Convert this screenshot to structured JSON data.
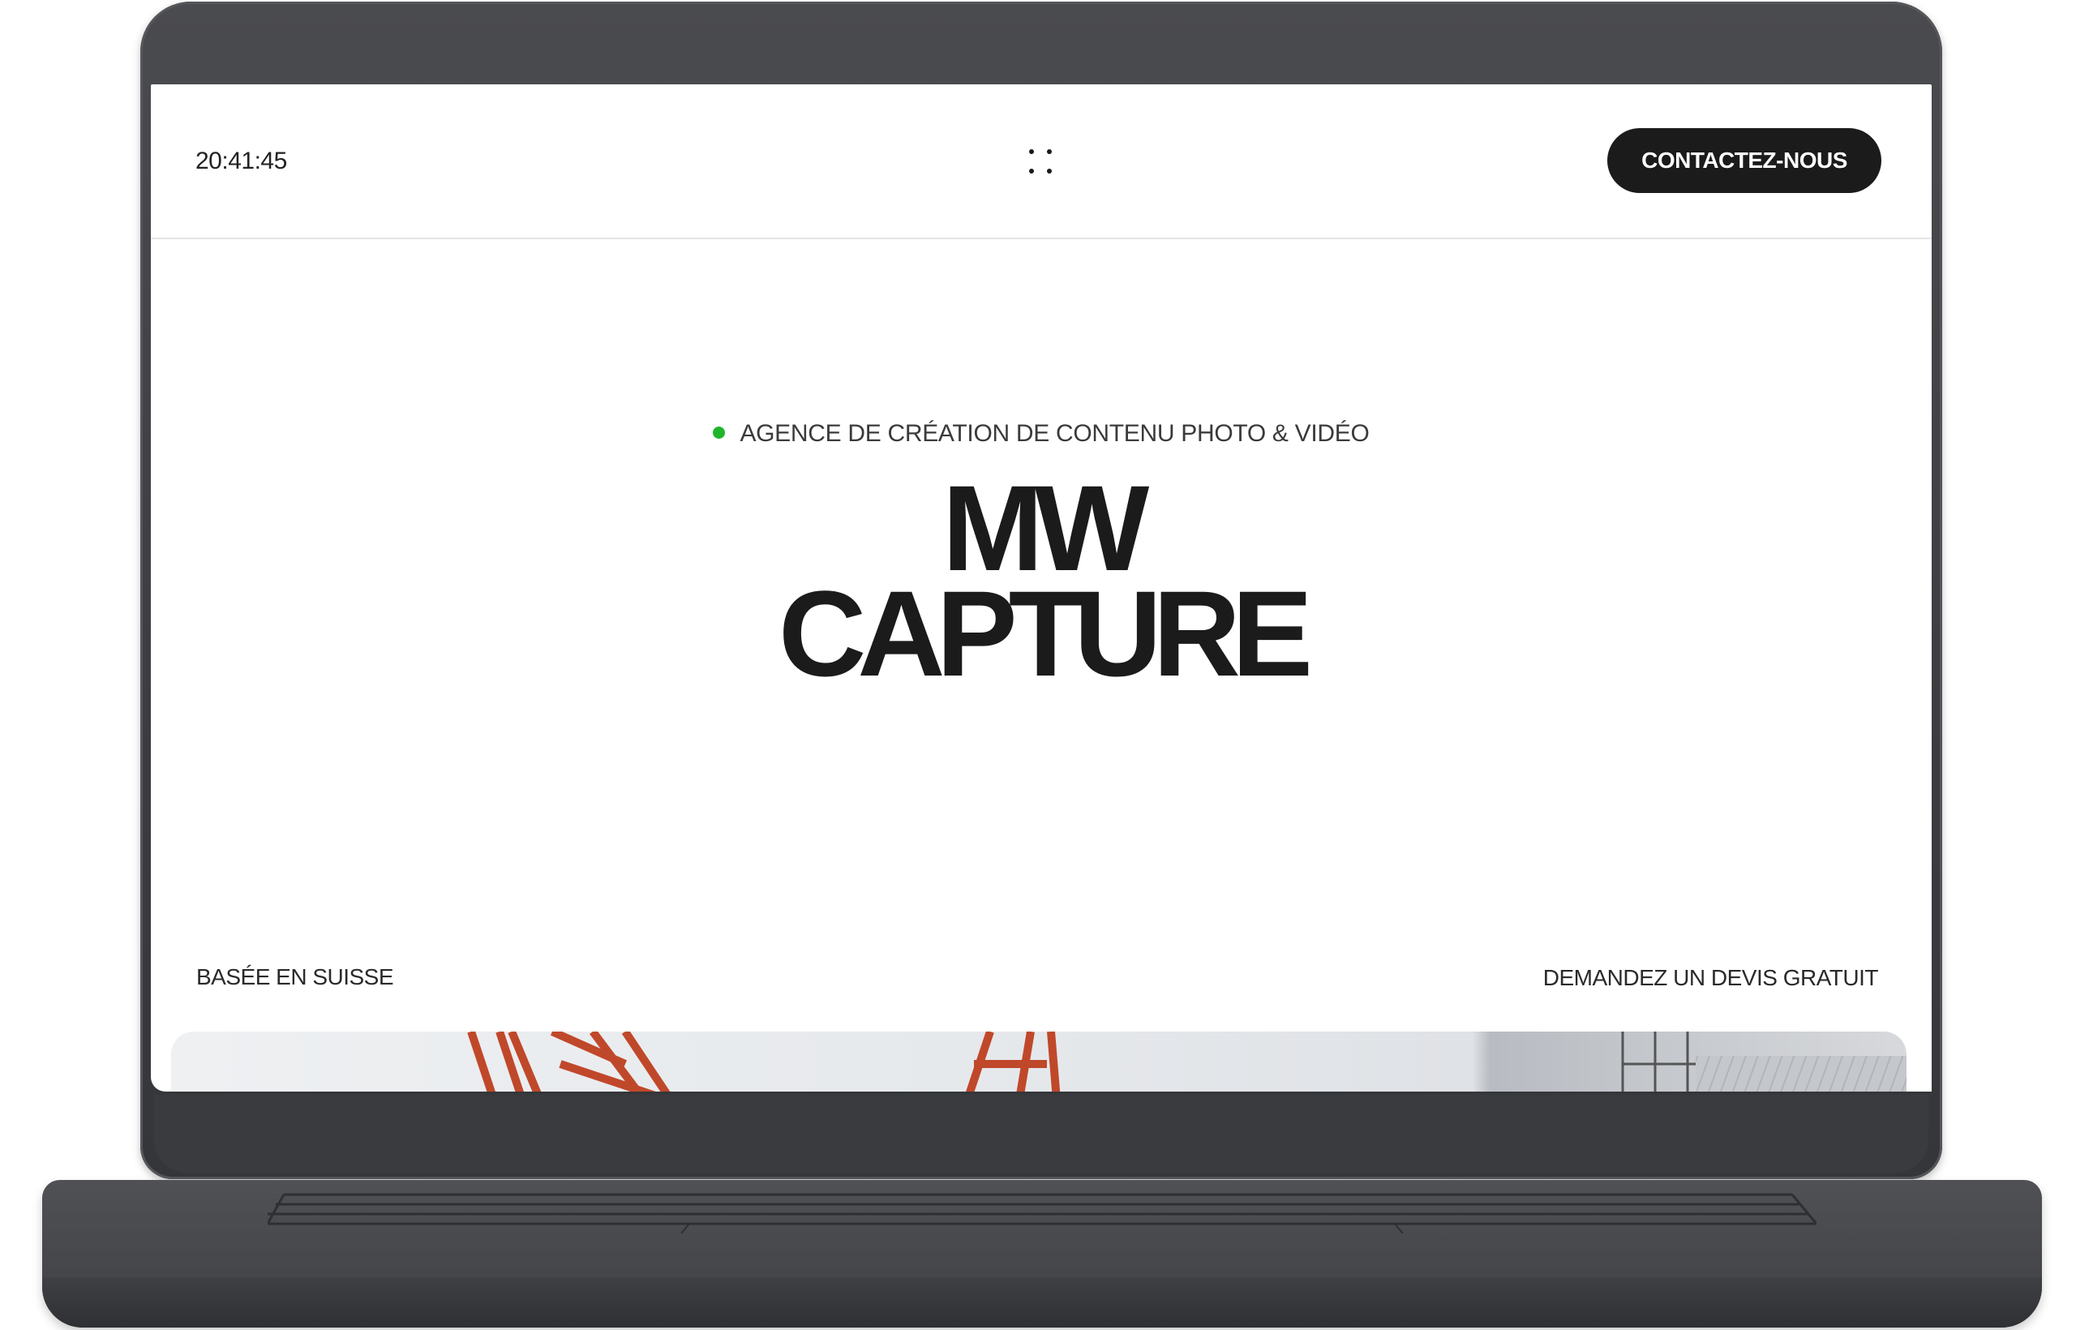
{
  "header": {
    "clock": "20:41:45",
    "menu_icon": "four-dots-menu-icon",
    "contact_label": "CONTACTEZ-NOUS"
  },
  "hero": {
    "tagline": "AGENCE DE CRÉATION DE CONTENU PHOTO & VIDÉO",
    "status_dot_color": "#1fb52a",
    "title_line1": "MW",
    "title_line2": "CAPTURE",
    "left_caption": "BASÉE EN SUISSE",
    "right_link": "DEMANDEZ UN DEVIS GRATUIT"
  },
  "colors": {
    "button_bg": "#1b1b1c",
    "laptop_body": "#3c3d40"
  }
}
